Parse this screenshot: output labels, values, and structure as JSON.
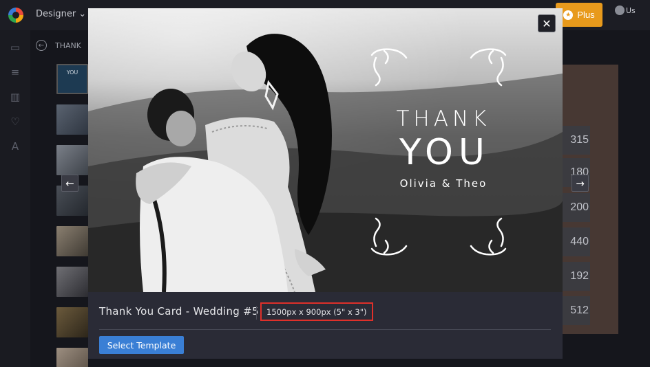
{
  "app": {
    "menu_label": "Designer",
    "plus_label": "Plus",
    "user_label": "Us",
    "back_label": "THANK"
  },
  "background": {
    "thumb0_label": "YOU",
    "size_items": [
      "315",
      "180",
      "200",
      "440",
      "192",
      "512"
    ]
  },
  "card": {
    "line1": "THANK",
    "line2": "YOU",
    "names": "Olivia & Theo"
  },
  "template": {
    "title": "Thank You Card - Wedding #5",
    "size": "1500px x 900px (5\" x 3\")",
    "select_label": "Select Template"
  },
  "icons": {
    "close": "close-icon",
    "prev": "arrow-left-icon",
    "next": "arrow-right-icon"
  },
  "colors": {
    "accent_button": "#3a7fd5",
    "plus_button": "#e89a1c",
    "highlight_box": "#e0302a"
  }
}
